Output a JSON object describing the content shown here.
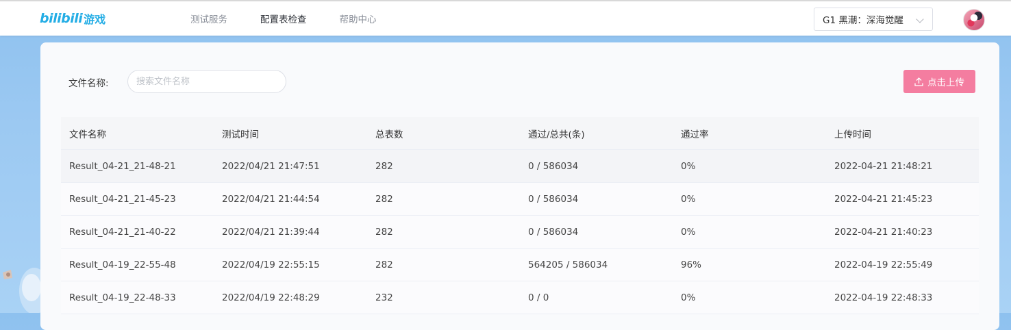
{
  "header": {
    "logo_text": "bilibili",
    "logo_suffix": "游戏",
    "nav": [
      {
        "label": "测试服务",
        "active": false
      },
      {
        "label": "配置表检查",
        "active": true
      },
      {
        "label": "帮助中心",
        "active": false
      }
    ],
    "game_select_value": "G1 黑潮：深海觉醒"
  },
  "filter": {
    "label": "文件名称:",
    "search_placeholder": "搜索文件名称",
    "upload_label": "点击上传"
  },
  "colors": {
    "brand_blue": "#23ade5",
    "upload_pink": "#f47da0",
    "background_blue": "#9cc9f2"
  },
  "table": {
    "columns": [
      "文件名称",
      "测试时间",
      "总表数",
      "通过/总共(条)",
      "通过率",
      "上传时间"
    ],
    "rows": [
      [
        "Result_04-21_21-48-21",
        "2022/04/21 21:47:51",
        "282",
        "0 / 586034",
        "0%",
        "2022-04-21 21:48:21"
      ],
      [
        "Result_04-21_21-45-23",
        "2022/04/21 21:44:54",
        "282",
        "0 / 586034",
        "0%",
        "2022-04-21 21:45:23"
      ],
      [
        "Result_04-21_21-40-22",
        "2022/04/21 21:39:44",
        "282",
        "0 / 586034",
        "0%",
        "2022-04-21 21:40:23"
      ],
      [
        "Result_04-19_22-55-48",
        "2022/04/19 22:55:15",
        "282",
        "564205 / 586034",
        "96%",
        "2022-04-19 22:55:49"
      ],
      [
        "Result_04-19_22-48-33",
        "2022/04/19 22:48:29",
        "232",
        "0 / 0",
        "0%",
        "2022-04-19 22:48:33"
      ]
    ]
  }
}
